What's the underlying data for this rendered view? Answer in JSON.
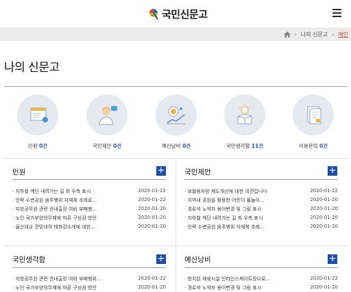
{
  "header": {
    "logo_text": "국민신문고"
  },
  "breadcrumb": {
    "items": [
      "나의 신문고",
      "메인"
    ]
  },
  "page_title": "나의 신문고",
  "stats": [
    {
      "label": "민원",
      "count": "0건",
      "icon": "document-icon"
    },
    {
      "label": "국민제안",
      "count": "0건",
      "icon": "person-idea-icon"
    },
    {
      "label": "예산낭비",
      "count": "0건",
      "icon": "coin-chart-icon"
    },
    {
      "label": "국민생각함",
      "count": "11건",
      "icon": "lightbulb-box-icon"
    },
    {
      "label": "이용문의",
      "count": "0건",
      "icon": "inquiry-icon"
    }
  ],
  "boards": [
    {
      "title": "민원",
      "rows": [
        {
          "text": "지하철 계단 내려가는 길 좌 우측 표시",
          "date": "2020-01-22"
        },
        {
          "text": "인략 수변공원 음주행위 자재체 조레로...",
          "date": "2020-01-22"
        },
        {
          "text": "지방공무원 관련 관내출장 여비 부패행...",
          "date": "2020-01-20"
        },
        {
          "text": "노인 국가부양의무제에 따른 구상권 방안",
          "date": "2020-01-20"
        },
        {
          "text": "울산대교 전망대의 태화강소개에 대한...",
          "date": "2020-01-20"
        }
      ]
    },
    {
      "title": "국민제안",
      "rows": [
        {
          "text": "보철용자랑 제도개선에 대한 의견입니다",
          "date": "2020-01-22"
        },
        {
          "text": "지역내 공원을 활용한 어린이 물놀이...",
          "date": "2020-01-20"
        },
        {
          "text": "경로석 노약자 용어변경 및 그림 표시",
          "date": "2020-01-20"
        },
        {
          "text": "지하철 계단 내려가는 길 좌 우측 표시",
          "date": "2020-01-20"
        },
        {
          "text": "인략 수변공원 음주행위 자재체 조레...",
          "date": "2020-01-20"
        }
      ]
    },
    {
      "title": "국민생각함",
      "rows": [
        {
          "text": "지방공무원 관련 관내출장 여비 부패행위...",
          "date": "2020-01-22"
        },
        {
          "text": "노인 국가부양의무제에 따른 구상권 방안",
          "date": "2020-01-20"
        }
      ]
    },
    {
      "title": "예산낭비",
      "rows": [
        {
          "text": "방치된 체육시설 인라인스케이트장으로...",
          "date": "2020-01-22"
        },
        {
          "text": "경로석 노약자 용어변경 및 그림 표시",
          "date": "2020-01-20"
        }
      ]
    }
  ],
  "colors": {
    "accent_blue": "#1c4ea3",
    "count_blue": "#2a57b4",
    "breadcrumb_current": "#d34a2a",
    "icon_bg": "#e6e9ef"
  },
  "icons": {
    "menu": "hamburger-icon",
    "home": "home-icon",
    "more": "plus-icon"
  }
}
